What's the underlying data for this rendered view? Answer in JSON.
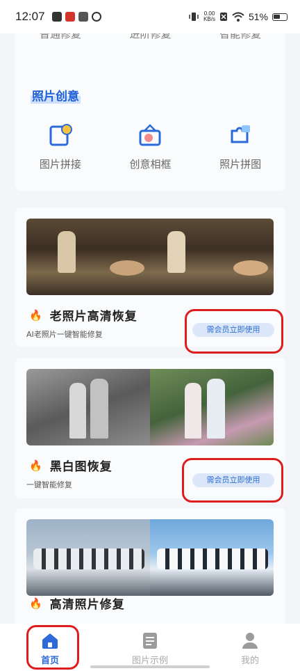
{
  "status_bar": {
    "time": "12:07",
    "net_speed_value": "0.00",
    "net_speed_unit": "KB/s",
    "battery": "51%"
  },
  "top_row": {
    "items": [
      "普通修复",
      "进阶修复",
      "智能修复"
    ]
  },
  "creative": {
    "title": "照片创意",
    "items": [
      {
        "label": "图片拼接",
        "icon": "image-splice-icon"
      },
      {
        "label": "创意相框",
        "icon": "photo-frame-icon"
      },
      {
        "label": "照片拼图",
        "icon": "puzzle-icon"
      }
    ]
  },
  "features": [
    {
      "title": "老照片高清恢复",
      "subtitle": "AI老照片一键智能修复",
      "button": "需会员立即使用"
    },
    {
      "title": "黑白图恢复",
      "subtitle": "一键智能修复",
      "button": "需会员立即使用"
    },
    {
      "title": "高清照片修复"
    }
  ],
  "bottom_nav": {
    "items": [
      {
        "label": "首页",
        "icon": "home-icon",
        "active": true
      },
      {
        "label": "图片示例",
        "icon": "document-icon",
        "active": false
      },
      {
        "label": "我的",
        "icon": "person-icon",
        "active": false
      }
    ]
  },
  "colors": {
    "accent": "#2b6ad8",
    "highlight_ring": "#dd1d1d"
  }
}
